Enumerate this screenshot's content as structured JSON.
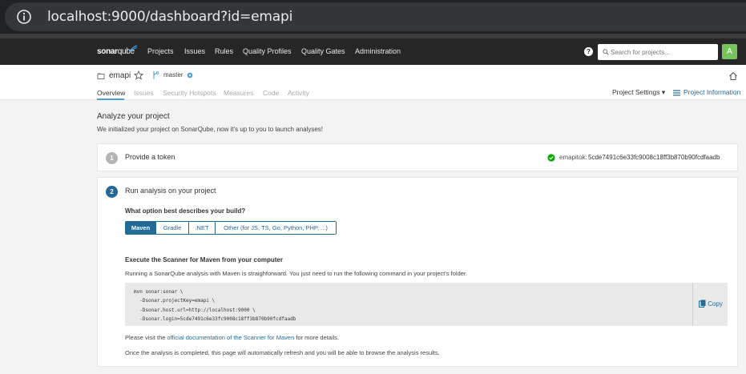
{
  "browser": {
    "url": "localhost:9000/dashboard?id=emapi"
  },
  "nav": {
    "logo_sonar": "sonar",
    "logo_qube": "qube",
    "items": [
      "Projects",
      "Issues",
      "Rules",
      "Quality Profiles",
      "Quality Gates",
      "Administration"
    ],
    "help": "?",
    "search_placeholder": "Search for projects...",
    "avatar": "A"
  },
  "project": {
    "name": "emapi",
    "branch": "master",
    "tabs": [
      "Overview",
      "Issues",
      "Security Hotspots",
      "Measures",
      "Code",
      "Activity"
    ],
    "settings": "Project Settings",
    "info": "Project Information"
  },
  "main": {
    "title": "Analyze your project",
    "subtitle": "We initialized your project on SonarQube, now it's up to you to launch analyses!",
    "step1": {
      "num": "1",
      "title": "Provide a token",
      "token_label": "emapitok:",
      "token_value": "5cde7491c6e33fc9008c18ff3b870b90fcdfaadb"
    },
    "step2": {
      "num": "2",
      "title": "Run analysis on your project",
      "question": "What option best describes your build?",
      "options": [
        "Maven",
        "Gradle",
        ".NET",
        "Other (for JS, TS, Go, Python, PHP, ...)"
      ],
      "exec_title": "Execute the Scanner for Maven from your computer",
      "exec_desc": "Running a SonarQube analysis with Maven is straighforward. You just need to run the following command in your project's folder.",
      "code": [
        "mvn sonar:sonar \\",
        "  -Dsonar.projectKey=emapi \\",
        "  -Dsonar.host.url=http://localhost:9000 \\",
        "  -Dsonar.login=5cde7491c6e33fc9008c18ff3b870b90fcdfaadb"
      ],
      "copy": "Copy",
      "visit_pre": "Please visit the ",
      "visit_link": "official documentation of the Scanner for Maven",
      "visit_post": " for more details.",
      "once": "Once the analysis is completed, this page will automatically refresh and you will be able to browse the analysis results."
    }
  },
  "colors": {
    "accent": "#236a97",
    "nav_bg": "#262626",
    "success": "#00aa00",
    "avatar": "#79c35f"
  }
}
